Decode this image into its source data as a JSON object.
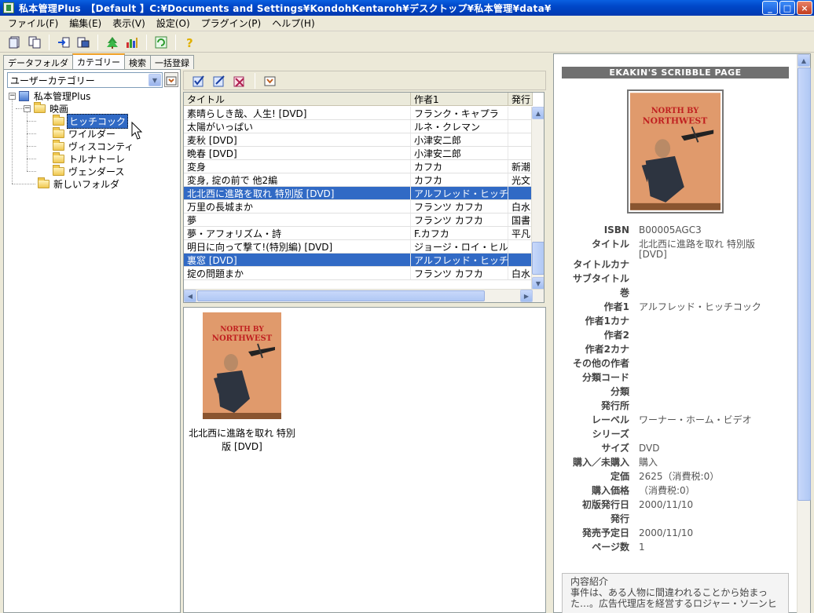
{
  "window": {
    "title": "私本管理Plus　【Default 】C:¥Documents and Settings¥KondohKentaroh¥デスクトップ¥私本管理¥data¥",
    "controls": [
      "_",
      "□",
      "×"
    ]
  },
  "menu": [
    "ファイル(F)",
    "編集(E)",
    "表示(V)",
    "設定(O)",
    "プラグイン(P)",
    "ヘルプ(H)"
  ],
  "tabs": [
    "データフォルダ",
    "カテゴリー",
    "検索",
    "一括登録"
  ],
  "category_select": "ユーザーカテゴリー",
  "tree": {
    "root": "私本管理Plus",
    "movie": "映画",
    "children": [
      "ヒッチコック",
      "ワイルダー",
      "ヴィスコンティ",
      "トルナトーレ",
      "ヴェンダース"
    ],
    "new_folder": "新しいフォルダ"
  },
  "grid": {
    "columns": [
      "タイトル",
      "作者1",
      "発行"
    ],
    "rows": [
      {
        "title": "素晴らしき哉、人生! [DVD]",
        "author": "フランク・キャプラ",
        "pub": ""
      },
      {
        "title": "太陽がいっぱい",
        "author": "ルネ・クレマン",
        "pub": ""
      },
      {
        "title": "麦秋 [DVD]",
        "author": "小津安二郎",
        "pub": ""
      },
      {
        "title": "晩春 [DVD]",
        "author": "小津安二郎",
        "pub": ""
      },
      {
        "title": "変身",
        "author": "カフカ",
        "pub": "新潮"
      },
      {
        "title": "変身, 掟の前で 他2編",
        "author": "カフカ",
        "pub": "光文"
      },
      {
        "title": "北北西に進路を取れ 特別版 [DVD]",
        "author": "アルフレッド・ヒッチコ...",
        "pub": ""
      },
      {
        "title": "万里の長城まか",
        "author": "フランツ カフカ",
        "pub": "白水"
      },
      {
        "title": "夢",
        "author": "フランツ カフカ",
        "pub": "国書"
      },
      {
        "title": "夢・アフォリズム・詩",
        "author": "F.カフカ",
        "pub": "平凡"
      },
      {
        "title": "明日に向って撃て!(特別編) [DVD]",
        "author": "ジョージ・ロイ・ヒル",
        "pub": ""
      },
      {
        "title": "裏窓 [DVD]",
        "author": "アルフレッド・ヒッチコ...",
        "pub": ""
      },
      {
        "title": "掟の問題まか",
        "author": "フランツ カフカ",
        "pub": "白水"
      }
    ],
    "selected_rows": [
      6,
      11
    ]
  },
  "preview": {
    "caption": "北北西に進路を取れ 特別版 [DVD]",
    "cover_title_line1": "NORTH BY",
    "cover_title_line2": "NORTHWEST"
  },
  "detail": {
    "header": "EKAKIN'S SCRIBBLE PAGE",
    "fields": [
      {
        "key": "ISBN",
        "value": "B00005AGC3"
      },
      {
        "key": "タイトル",
        "value": "北北西に進路を取れ 特別版 [DVD]"
      },
      {
        "key": "タイトルカナ",
        "value": ""
      },
      {
        "key": "サブタイトル",
        "value": ""
      },
      {
        "key": "巻",
        "value": ""
      },
      {
        "key": "作者1",
        "value": "アルフレッド・ヒッチコック"
      },
      {
        "key": "作者1カナ",
        "value": ""
      },
      {
        "key": "作者2",
        "value": ""
      },
      {
        "key": "作者2カナ",
        "value": ""
      },
      {
        "key": "その他の作者",
        "value": ""
      },
      {
        "key": "分類コード",
        "value": ""
      },
      {
        "key": "分類",
        "value": ""
      },
      {
        "key": "発行所",
        "value": ""
      },
      {
        "key": "レーベル",
        "value": "ワーナー・ホーム・ビデオ"
      },
      {
        "key": "シリーズ",
        "value": ""
      },
      {
        "key": "サイズ",
        "value": "DVD"
      },
      {
        "key": "購入／未購入",
        "value": "購入"
      },
      {
        "key": "定価",
        "value": "2625（消費税:0）"
      },
      {
        "key": "購入価格",
        "value": "（消費税:0）"
      },
      {
        "key": "初版発行日",
        "value": "2000/11/10"
      },
      {
        "key": "発行",
        "value": ""
      },
      {
        "key": "発売予定日",
        "value": "2000/11/10"
      },
      {
        "key": "ページ数",
        "value": "1"
      }
    ],
    "description_label": "内容紹介",
    "description_text": "事件は、ある人物に間違われることから始まった…。広告代理店を経営するロジャー・ソーンヒ"
  },
  "colors": {
    "selection": "#316ac5",
    "titlebar": "#0047c8"
  }
}
